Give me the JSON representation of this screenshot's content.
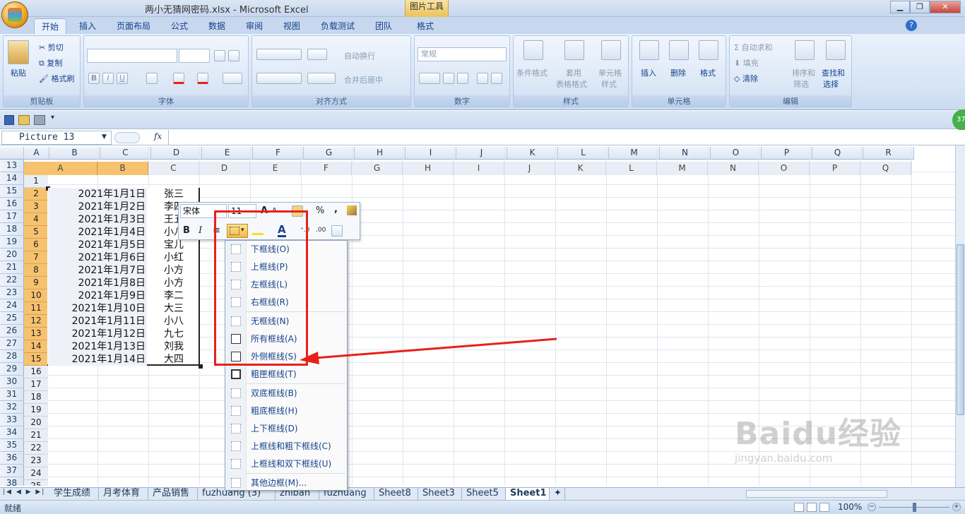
{
  "window": {
    "title": "两小无猜网密码.xlsx - Microsoft Excel",
    "context_tab": "图片工具",
    "min": "0",
    "max": "1",
    "close": "r"
  },
  "tabs": [
    "开始",
    "插入",
    "页面布局",
    "公式",
    "数据",
    "审阅",
    "视图",
    "负载测试",
    "团队",
    "格式"
  ],
  "ribbon": {
    "clipboard": {
      "label": "剪贴板",
      "paste": "粘贴",
      "cut": "剪切",
      "copy": "复制",
      "format_painter": "格式刷"
    },
    "font": {
      "label": "字体"
    },
    "alignment": {
      "label": "对齐方式",
      "wrap": "自动换行",
      "merge": "合并后居中"
    },
    "number": {
      "label": "数字",
      "format": "常规"
    },
    "styles": {
      "label": "样式",
      "cond": "条件格式",
      "table1": "套用",
      "table2": "表格格式",
      "cell1": "单元格",
      "cell2": "样式"
    },
    "cells": {
      "label": "单元格",
      "insert": "插入",
      "delete": "删除",
      "format": "格式"
    },
    "editing": {
      "label": "编辑",
      "autosum": "自动求和",
      "fill": "填充",
      "clear": "清除",
      "sort1": "排序和",
      "sort2": "筛选",
      "find1": "查找和",
      "find2": "选择"
    }
  },
  "formula_bar": {
    "name_box": "Picture 13",
    "fx": "fx"
  },
  "colors": {
    "selection_header": "#f7c26f",
    "red_annotation": "#e8201a"
  },
  "grid": {
    "columns": [
      "A",
      "B",
      "C",
      "D",
      "E",
      "F",
      "G",
      "H",
      "I",
      "J",
      "K",
      "L",
      "M",
      "N",
      "O",
      "P",
      "Q",
      "R"
    ],
    "rows": [
      "13",
      "14",
      "15",
      "16",
      "17",
      "18",
      "19",
      "20",
      "21",
      "22",
      "23",
      "24",
      "25",
      "26",
      "27",
      "28",
      "29",
      "30",
      "31",
      "32",
      "33",
      "34",
      "35",
      "36",
      "37",
      "38"
    ]
  },
  "picture": {
    "columns": [
      "A",
      "B",
      "C",
      "D",
      "E",
      "F",
      "G",
      "H",
      "I",
      "J",
      "K",
      "L",
      "M",
      "N",
      "O",
      "P",
      "Q"
    ],
    "rows": [
      "1",
      "2",
      "3",
      "4",
      "5",
      "6",
      "7",
      "8",
      "9",
      "10",
      "11",
      "12",
      "13",
      "14",
      "15",
      "16",
      "17",
      "18",
      "19",
      "20",
      "21",
      "22",
      "23",
      "24",
      "25"
    ],
    "data": [
      [
        "2021年1月1日",
        "张三"
      ],
      [
        "2021年1月2日",
        "李四"
      ],
      [
        "2021年1月3日",
        "王五"
      ],
      [
        "2021年1月4日",
        "小八"
      ],
      [
        "2021年1月5日",
        "宝儿"
      ],
      [
        "2021年1月6日",
        "小红"
      ],
      [
        "2021年1月7日",
        "小方"
      ],
      [
        "2021年1月8日",
        "小方"
      ],
      [
        "2021年1月9日",
        "李二"
      ],
      [
        "2021年1月10日",
        "大三"
      ],
      [
        "2021年1月11日",
        "小八"
      ],
      [
        "2021年1月12日",
        "九七"
      ],
      [
        "2021年1月13日",
        "刘我"
      ],
      [
        "2021年1月14日",
        "大四"
      ]
    ]
  },
  "mini_toolbar": {
    "font": "宋体",
    "size": "11",
    "bold": "B",
    "italic": "I",
    "percent": "%",
    "comma": ","
  },
  "border_menu": {
    "items": [
      "下框线(O)",
      "上框线(P)",
      "左框线(L)",
      "右框线(R)",
      "无框线(N)",
      "所有框线(A)",
      "外侧框线(S)",
      "粗匣框线(T)",
      "双底框线(B)",
      "粗底框线(H)",
      "上下框线(D)",
      "上框线和粗下框线(C)",
      "上框线和双下框线(U)",
      "其他边框(M)..."
    ]
  },
  "sheet_tabs": [
    "学生成绩",
    "月考体育",
    "产品销售",
    "fuzhuang (3)",
    "zhiban",
    "fuzhuang",
    "Sheet8",
    "Sheet3",
    "Sheet5",
    "Sheet1"
  ],
  "status": {
    "ready": "就绪",
    "zoom": "100%",
    "badge": "37"
  },
  "watermark": {
    "brand": "Baidu经验",
    "url": "jingyan.baidu.com"
  }
}
